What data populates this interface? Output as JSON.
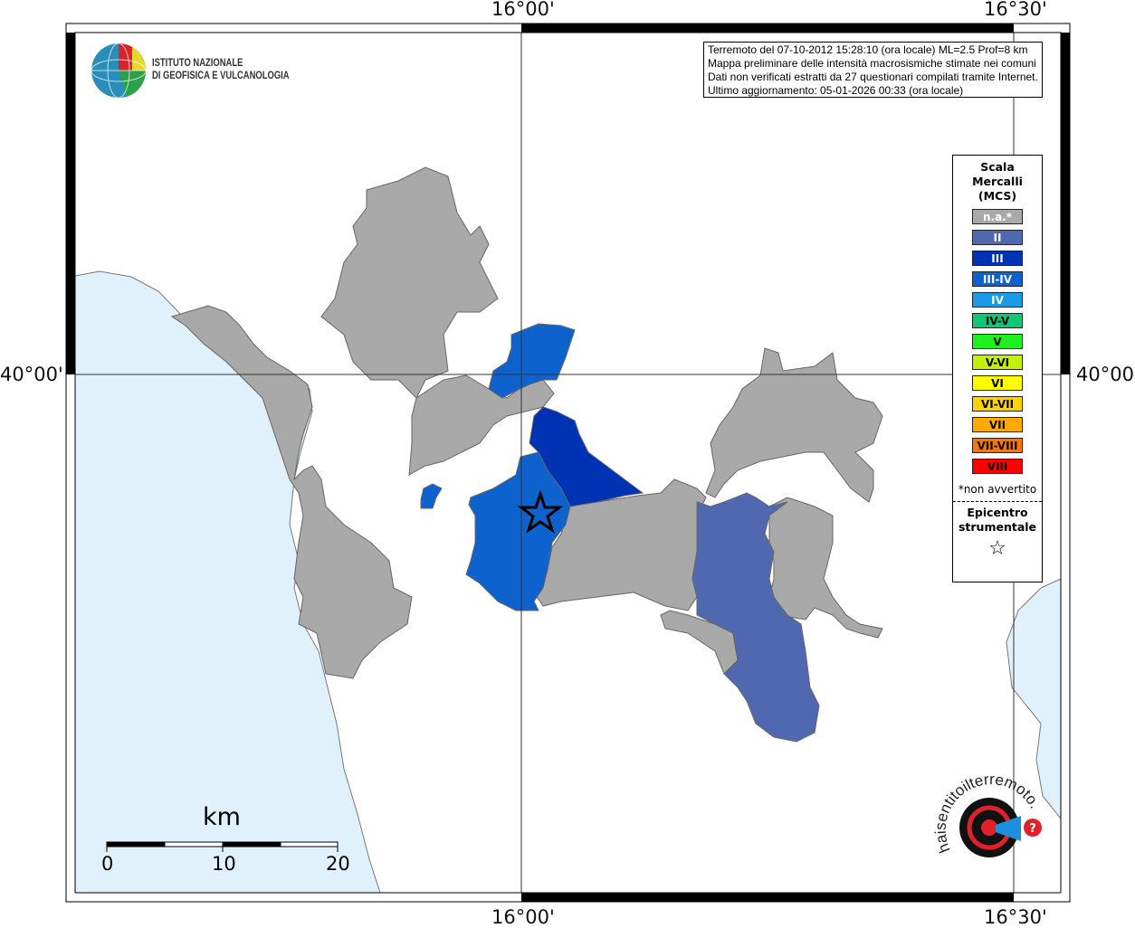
{
  "axes": {
    "lon_labels": [
      "16°00'",
      "16°30'"
    ],
    "lat_labels": [
      "40°00'"
    ]
  },
  "info_box": {
    "lines": [
      "Terremoto del 07-10-2012 15:28:10 (ora locale) ML=2.5 Prof=8 km",
      "Mappa preliminare delle intensità macrosismiche stimate nei comuni",
      "Dati non verificati estratti da 27 questionari compilati tramite Internet.",
      "Ultimo aggiornamento: 05-01-2026 00:33 (ora locale)"
    ]
  },
  "logo_ingv": {
    "line1": "ISTITUTO NAZIONALE",
    "line2": "DI GEOFISICA E VULCANOLOGIA"
  },
  "logo_hsit": {
    "text": "www.haisentitoilterremoto.it"
  },
  "legend": {
    "title": [
      "Scala",
      "Mercalli",
      "(MCS)"
    ],
    "items": [
      {
        "label": "n.a.*",
        "color": "#a9a9a9",
        "text_color": "#ffffff"
      },
      {
        "label": "II",
        "color": "#5068b0",
        "text_color": "#ffffff"
      },
      {
        "label": "III",
        "color": "#0032b4",
        "text_color": "#ffffff"
      },
      {
        "label": "III-IV",
        "color": "#0e62cd",
        "text_color": "#ffffff"
      },
      {
        "label": "IV",
        "color": "#1b9be6",
        "text_color": "#ffffff"
      },
      {
        "label": "IV-V",
        "color": "#0ec878",
        "text_color": "#000000"
      },
      {
        "label": "V",
        "color": "#1ef01e",
        "text_color": "#000000"
      },
      {
        "label": "V-VI",
        "color": "#c3f00a",
        "text_color": "#000000"
      },
      {
        "label": "VI",
        "color": "#ffff00",
        "text_color": "#000000"
      },
      {
        "label": "VI-VII",
        "color": "#ffd200",
        "text_color": "#000000"
      },
      {
        "label": "VII",
        "color": "#ffaa00",
        "text_color": "#000000"
      },
      {
        "label": "VII-VIII",
        "color": "#ff7300",
        "text_color": "#000000"
      },
      {
        "label": "VIII",
        "color": "#ff0000",
        "text_color": "#000000"
      }
    ],
    "note": "*non avvertito",
    "epicenter_title": [
      "Epicentro",
      "strumentale"
    ],
    "epicenter_symbol": "☆"
  },
  "scale_bar": {
    "unit": "km",
    "ticks": [
      "0",
      "10",
      "20"
    ]
  },
  "colors": {
    "sea": "#e1f1fc",
    "border": "#555555"
  }
}
